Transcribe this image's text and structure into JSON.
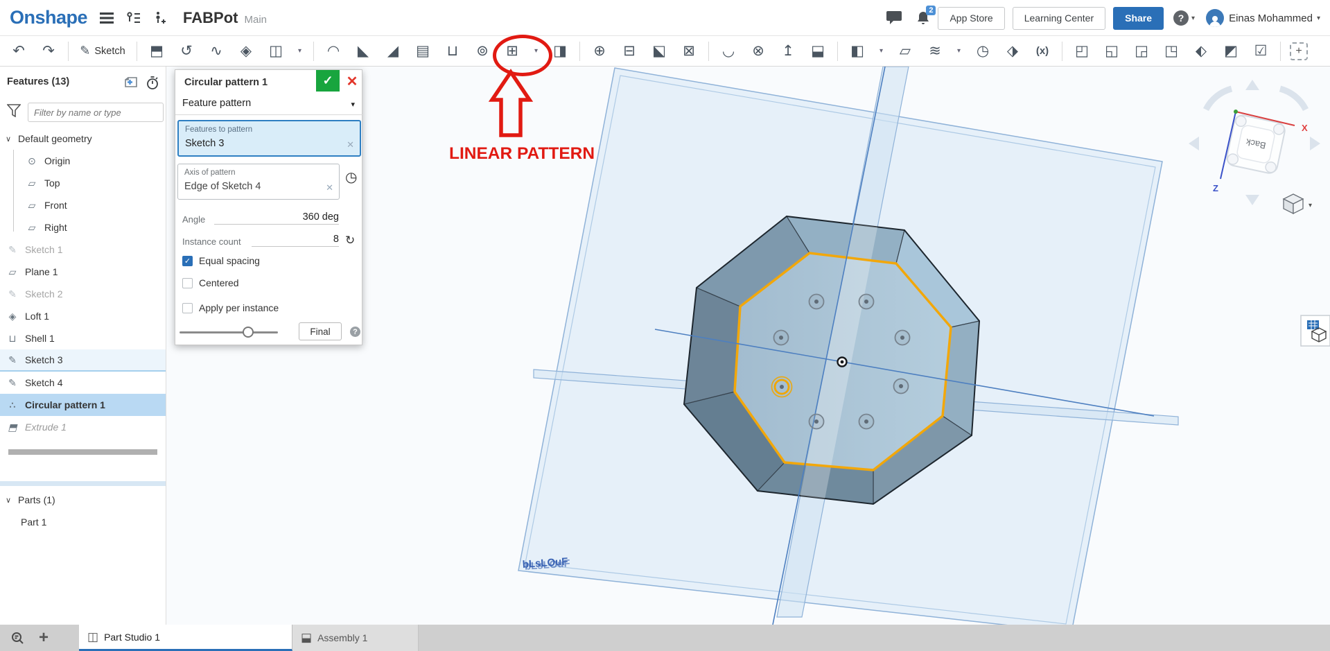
{
  "topbar": {
    "logo": "Onshape",
    "doc_title": "FABPot",
    "branch": "Main",
    "notification_count": "2",
    "app_store": "App Store",
    "learning_center": "Learning Center",
    "share": "Share",
    "user_name": "Einas Mohammed"
  },
  "toolbar": {
    "items": [
      {
        "name": "undo-icon",
        "glyph": "↶"
      },
      {
        "name": "redo-icon",
        "glyph": "↷"
      },
      {
        "name": "separator",
        "cls": "sep"
      },
      {
        "name": "sketch-button",
        "glyph": "✎",
        "label": "Sketch",
        "cls": "sketch"
      },
      {
        "name": "separator",
        "cls": "sep"
      },
      {
        "name": "extrude-icon",
        "glyph": "⬒"
      },
      {
        "name": "revolve-icon",
        "glyph": "↺"
      },
      {
        "name": "sweep-icon",
        "glyph": "∿"
      },
      {
        "name": "loft-icon",
        "glyph": "◈"
      },
      {
        "name": "thicken-icon",
        "glyph": "◫"
      },
      {
        "name": "chevron-down-icon",
        "glyph": "▾",
        "cls": "caret-i"
      },
      {
        "name": "separator",
        "cls": "sep"
      },
      {
        "name": "fillet-icon",
        "glyph": "◠"
      },
      {
        "name": "chamfer-icon",
        "glyph": "◣"
      },
      {
        "name": "draft-icon",
        "glyph": "◢"
      },
      {
        "name": "rib-icon",
        "glyph": "▤"
      },
      {
        "name": "shell-icon",
        "glyph": "⊔"
      },
      {
        "name": "hole-icon",
        "glyph": "⊚"
      },
      {
        "name": "linear-pattern-icon",
        "glyph": "⊞",
        "cls": "circled"
      },
      {
        "name": "chevron-down-icon",
        "glyph": "▾",
        "cls": "caret-i"
      },
      {
        "name": "mirror-icon",
        "glyph": "◨"
      },
      {
        "name": "separator",
        "cls": "sep"
      },
      {
        "name": "boolean-icon",
        "glyph": "⊕"
      },
      {
        "name": "split-icon",
        "glyph": "⊟"
      },
      {
        "name": "transform-icon",
        "glyph": "⬕"
      },
      {
        "name": "delete-part-icon",
        "glyph": "⊠"
      },
      {
        "name": "separator",
        "cls": "sep"
      },
      {
        "name": "fillet-surface-icon",
        "glyph": "◡"
      },
      {
        "name": "delete-face-icon",
        "glyph": "⊗"
      },
      {
        "name": "move-face-icon",
        "glyph": "↥"
      },
      {
        "name": "replace-face-icon",
        "glyph": "⬓"
      },
      {
        "name": "separator",
        "cls": "sep"
      },
      {
        "name": "surface-icon",
        "glyph": "◧"
      },
      {
        "name": "chevron-down-icon",
        "glyph": "▾",
        "cls": "caret-i"
      },
      {
        "name": "plane-icon",
        "glyph": "▱"
      },
      {
        "name": "helix-icon",
        "glyph": "≋"
      },
      {
        "name": "chevron-down-icon",
        "glyph": "▾",
        "cls": "caret-i"
      },
      {
        "name": "point-icon",
        "glyph": "◷"
      },
      {
        "name": "import-icon",
        "glyph": "⬗"
      },
      {
        "name": "variable-icon",
        "glyph": "(x)",
        "cls": "varx"
      },
      {
        "name": "separator",
        "cls": "sep"
      },
      {
        "name": "sheet-metal-flange-icon",
        "glyph": "◰"
      },
      {
        "name": "sheet-metal-bend-icon",
        "glyph": "◱"
      },
      {
        "name": "sheet-metal-tab-icon",
        "glyph": "◲"
      },
      {
        "name": "sheet-metal-joint-icon",
        "glyph": "◳"
      },
      {
        "name": "sheet-metal-unfold-icon",
        "glyph": "⬖"
      },
      {
        "name": "sheet-metal-corner-icon",
        "glyph": "◩"
      },
      {
        "name": "sheet-metal-finish-icon",
        "glyph": "☑"
      },
      {
        "name": "separator",
        "cls": "sep"
      },
      {
        "name": "custom-feature-icon",
        "glyph": "+",
        "cls": "custom"
      }
    ]
  },
  "features_panel": {
    "title": "Features (13)",
    "filter_placeholder": "Filter by name or type",
    "tree": [
      {
        "label": "Default geometry"
      },
      {
        "label": "Origin"
      },
      {
        "label": "Top"
      },
      {
        "label": "Front"
      },
      {
        "label": "Right"
      },
      {
        "label": "Sketch 1"
      },
      {
        "label": "Plane 1"
      },
      {
        "label": "Sketch 2"
      },
      {
        "label": "Loft 1"
      },
      {
        "label": "Shell 1"
      },
      {
        "label": "Sketch 3"
      },
      {
        "label": "Sketch 4"
      },
      {
        "label": "Circular pattern 1"
      },
      {
        "label": "Extrude 1"
      }
    ],
    "parts_title": "Parts (1)",
    "parts": [
      {
        "label": "Part 1"
      }
    ]
  },
  "dialog": {
    "title": "Circular pattern 1",
    "pattern_type": "Feature pattern",
    "features_field": {
      "label": "Features to pattern",
      "value": "Sketch 3"
    },
    "axis_field": {
      "label": "Axis of pattern",
      "value": "Edge of Sketch 4"
    },
    "angle_label": "Angle",
    "angle_value": "360 deg",
    "count_label": "Instance count",
    "count_value": "8",
    "checkbox_equal_spacing": "Equal spacing",
    "checkbox_centered": "Centered",
    "checkbox_apply_per_instance": "Apply per instance",
    "final_label": "Final"
  },
  "annotation": {
    "label": "LINEAR PATTERN"
  },
  "viewport": {
    "plane_label": "bLsLOuF",
    "view_cube": {
      "face": "Back",
      "axis_x": "X",
      "axis_z": "Z"
    }
  },
  "bottombar": {
    "tab1": "Part Studio 1",
    "tab2": "Assembly 1"
  },
  "icons": {
    "caret_down": "∨",
    "caret_solid": "▾",
    "check": "✓",
    "close": "✕",
    "clear": "✕",
    "refresh": "↻",
    "direction_toggle": "◷",
    "help": "?",
    "origin": "⊙",
    "plane": "▱",
    "sketch": "✎",
    "loft": "◈",
    "shell": "⊔",
    "pattern": "∴",
    "extrude": "⬒",
    "part_studio": "◫",
    "assembly": "⬓",
    "plus": "+"
  },
  "colors": {
    "accent_blue": "#2a6fb7",
    "selection_blue": "#b9d9f3",
    "highlight_orange": "#f2a70a",
    "annotation_red": "#e11a12",
    "plane_edge_blue": "#8fb2d8"
  }
}
